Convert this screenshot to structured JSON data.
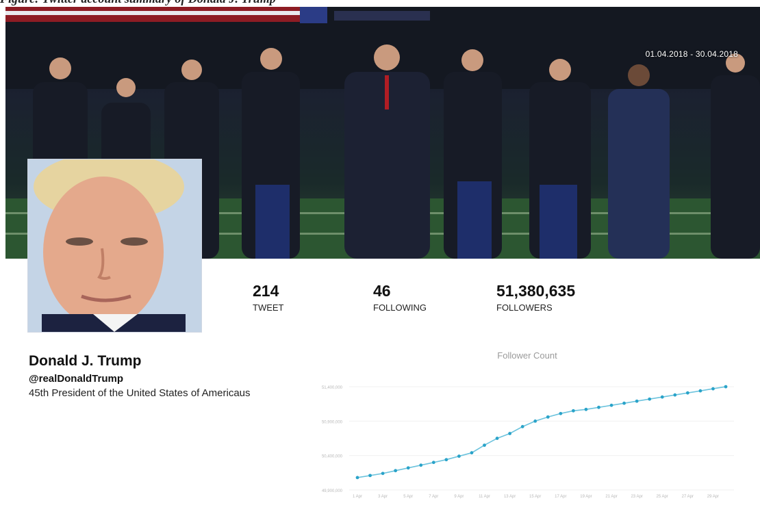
{
  "caption": "Figure: Twitter account summary of Donald J. Trump",
  "banner": {
    "date_range": "01.04.2018 - 30.04.2018"
  },
  "profile": {
    "name": "Donald J. Trump",
    "handle": "@realDonaldTrump",
    "bio": "45th President of the United States of Americaus"
  },
  "stats": [
    {
      "value": "214",
      "label": "TWEET"
    },
    {
      "value": "46",
      "label": "FOLLOWING"
    },
    {
      "value": "51,380,635",
      "label": "FOLLOWERS"
    }
  ],
  "colors": {
    "line": "#6cc3dd",
    "point": "#2aa3c9",
    "grid": "#f0f0f0",
    "axis_text": "#b8b8b8"
  },
  "chart_data": {
    "type": "line",
    "title": "Follower Count",
    "xlabel": "",
    "ylabel": "",
    "ylim": [
      49900000,
      51600000
    ],
    "yticks": [
      49900000,
      50400000,
      50900000,
      51400000
    ],
    "ytick_labels": [
      "49,900,000",
      "50,400,000",
      "50,900,000",
      "51,400,000"
    ],
    "x": [
      "1 Apr",
      "2 Apr",
      "3 Apr",
      "4 Apr",
      "5 Apr",
      "6 Apr",
      "7 Apr",
      "8 Apr",
      "9 Apr",
      "10 Apr",
      "11 Apr",
      "12 Apr",
      "13 Apr",
      "14 Apr",
      "15 Apr",
      "16 Apr",
      "17 Apr",
      "18 Apr",
      "19 Apr",
      "20 Apr",
      "21 Apr",
      "22 Apr",
      "23 Apr",
      "24 Apr",
      "25 Apr",
      "26 Apr",
      "27 Apr",
      "28 Apr",
      "29 Apr",
      "30 Apr"
    ],
    "xtick_labels": [
      "1 Apr",
      "3 Apr",
      "5 Apr",
      "7 Apr",
      "9 Apr",
      "11 Apr",
      "13 Apr",
      "15 Apr",
      "17 Apr",
      "19 Apr",
      "21 Apr",
      "23 Apr",
      "25 Apr",
      "27 Apr",
      "29 Apr"
    ],
    "series": [
      {
        "name": "",
        "values": [
          50080000,
          50110000,
          50140000,
          50180000,
          50220000,
          50260000,
          50300000,
          50340000,
          50390000,
          50440000,
          50550000,
          50650000,
          50720000,
          50820000,
          50900000,
          50960000,
          51010000,
          51050000,
          51070000,
          51100000,
          51130000,
          51160000,
          51190000,
          51220000,
          51250000,
          51280000,
          51310000,
          51340000,
          51370000,
          51400000
        ]
      }
    ],
    "grid": true,
    "legend": "none"
  }
}
